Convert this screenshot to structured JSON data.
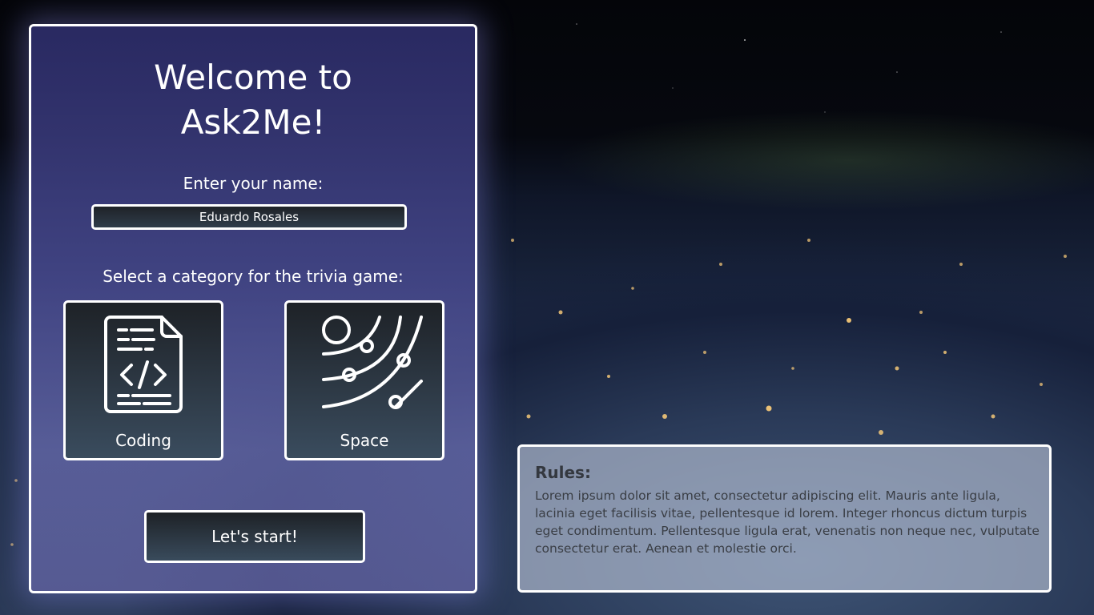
{
  "app": {
    "title_line1": "Welcome to",
    "title_line2": "Ask2Me!"
  },
  "name_section": {
    "label": "Enter your name:",
    "input_value": "Eduardo Rosales"
  },
  "category_section": {
    "label": "Select a category for the trivia game:",
    "categories": [
      {
        "label": "Coding",
        "icon": "code-file-icon"
      },
      {
        "label": "Space",
        "icon": "orbit-icon"
      }
    ]
  },
  "start_button": {
    "label": "Let's start!"
  },
  "rules": {
    "title": "Rules:",
    "text": "Lorem ipsum dolor sit amet, consectetur adipiscing elit. Mauris ante ligula, lacinia eget facilisis vitae, pellentesque id lorem. Integer rhoncus dictum turpis eget condimentum. Pellentesque ligula erat, venenatis non neque nec, vulputate consectetur erat. Aenean et molestie orci."
  },
  "colors": {
    "panel_border": "#ffffff",
    "button_dark": "#1e2227",
    "button_light": "#394b5c",
    "rules_text": "#3a3e45"
  }
}
